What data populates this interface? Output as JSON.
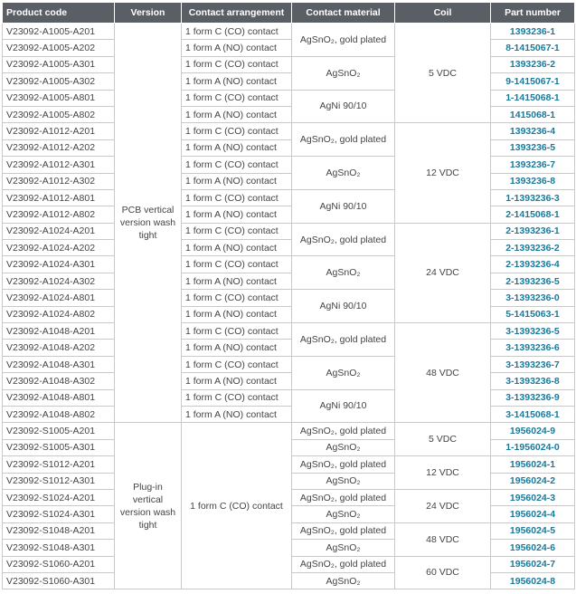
{
  "headers": {
    "product_code": "Product code",
    "version": "Version",
    "contact_arrangement": "Contact arrangement",
    "contact_material": "Contact material",
    "coil": "Coil",
    "part_number": "Part number"
  },
  "rows": [
    {
      "code": "V23092-A1005-A201",
      "arrangement": "1 form C (CO) contact",
      "part": "1393236-1"
    },
    {
      "code": "V23092-A1005-A202",
      "arrangement": "1 form A (NO) contact",
      "part": "8-1415067-1"
    },
    {
      "code": "V23092-A1005-A301",
      "arrangement": "1 form C (CO) contact",
      "part": "1393236-2"
    },
    {
      "code": "V23092-A1005-A302",
      "arrangement": "1 form A (NO) contact",
      "part": "9-1415067-1"
    },
    {
      "code": "V23092-A1005-A801",
      "arrangement": "1 form C (CO) contact",
      "part": "1-1415068-1"
    },
    {
      "code": "V23092-A1005-A802",
      "arrangement": "1 form A (NO) contact",
      "part": "1415068-1"
    },
    {
      "code": "V23092-A1012-A201",
      "arrangement": "1 form C (CO) contact",
      "part": "1393236-4"
    },
    {
      "code": "V23092-A1012-A202",
      "arrangement": "1 form A (NO) contact",
      "part": "1393236-5"
    },
    {
      "code": "V23092-A1012-A301",
      "arrangement": "1 form C (CO) contact",
      "part": "1393236-7"
    },
    {
      "code": "V23092-A1012-A302",
      "arrangement": "1 form A (NO) contact",
      "part": "1393236-8"
    },
    {
      "code": "V23092-A1012-A801",
      "arrangement": "1 form C (CO) contact",
      "part": "1-1393236-3"
    },
    {
      "code": "V23092-A1012-A802",
      "arrangement": "1 form A (NO) contact",
      "part": "2-1415068-1"
    },
    {
      "code": "V23092-A1024-A201",
      "arrangement": "1 form C (CO) contact",
      "part": "2-1393236-1"
    },
    {
      "code": "V23092-A1024-A202",
      "arrangement": "1 form A (NO) contact",
      "part": "2-1393236-2"
    },
    {
      "code": "V23092-A1024-A301",
      "arrangement": "1 form C (CO) contact",
      "part": "2-1393236-4"
    },
    {
      "code": "V23092-A1024-A302",
      "arrangement": "1 form A (NO) contact",
      "part": "2-1393236-5"
    },
    {
      "code": "V23092-A1024-A801",
      "arrangement": "1 form C (CO) contact",
      "part": "3-1393236-0"
    },
    {
      "code": "V23092-A1024-A802",
      "arrangement": "1 form A (NO) contact",
      "part": "5-1415063-1"
    },
    {
      "code": "V23092-A1048-A201",
      "arrangement": "1 form C (CO) contact",
      "part": "3-1393236-5"
    },
    {
      "code": "V23092-A1048-A202",
      "arrangement": "1 form A (NO) contact",
      "part": "3-1393236-6"
    },
    {
      "code": "V23092-A1048-A301",
      "arrangement": "1 form C (CO) contact",
      "part": "3-1393236-7"
    },
    {
      "code": "V23092-A1048-A302",
      "arrangement": "1 form A (NO) contact",
      "part": "3-1393236-8"
    },
    {
      "code": "V23092-A1048-A801",
      "arrangement": "1 form C (CO) contact",
      "part": "3-1393236-9"
    },
    {
      "code": "V23092-A1048-A802",
      "arrangement": "1 form A (NO) contact",
      "part": "3-1415068-1"
    },
    {
      "code": "V23092-S1005-A201",
      "material": "AgSnO₂, gold plated",
      "part": "1956024-9"
    },
    {
      "code": "V23092-S1005-A301",
      "material": "AgSnO₂",
      "part": "1-1956024-0"
    },
    {
      "code": "V23092-S1012-A201",
      "material": "AgSnO₂, gold plated",
      "part": "1956024-1"
    },
    {
      "code": "V23092-S1012-A301",
      "material": "AgSnO₂",
      "part": "1956024-2"
    },
    {
      "code": "V23092-S1024-A201",
      "material": "AgSnO₂, gold plated",
      "part": "1956024-3"
    },
    {
      "code": "V23092-S1024-A301",
      "material": "AgSnO₂",
      "part": "1956024-4"
    },
    {
      "code": "V23092-S1048-A201",
      "material": "AgSnO₂, gold plated",
      "part": "1956024-5"
    },
    {
      "code": "V23092-S1048-A301",
      "material": "AgSnO₂",
      "part": "1956024-6"
    },
    {
      "code": "V23092-S1060-A201",
      "material": "AgSnO₂, gold plated",
      "part": "1956024-7"
    },
    {
      "code": "V23092-S1060-A301",
      "material": "AgSnO₂",
      "part": "1956024-8"
    }
  ],
  "versions": {
    "pcb": "PCB vertical version wash tight",
    "plugin": "Plug-in vertical version wash tight"
  },
  "pcb_materials": [
    "AgSnO₂, gold plated",
    "AgSnO₂",
    "AgNi 90/10"
  ],
  "pcb_coils": [
    "5 VDC",
    "12 VDC",
    "24 VDC",
    "48 VDC"
  ],
  "plugin_arrangement": "1 form C (CO) contact",
  "plugin_coils": [
    "5 VDC",
    "12 VDC",
    "24 VDC",
    "48 VDC",
    "60 VDC"
  ],
  "colors": {
    "header_bg": "#5a5f66",
    "part_number": "#1a7a9c",
    "border": "#c9c9c9"
  }
}
